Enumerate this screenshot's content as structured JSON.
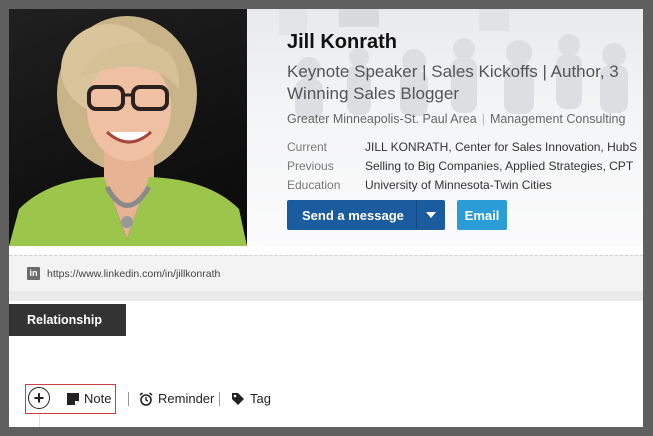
{
  "profile": {
    "name": "Jill Konrath",
    "headline_line1": "Keynote Speaker | Sales Kickoffs | Author, 3",
    "headline_line2": "Winning Sales Blogger",
    "location": "Greater Minneapolis-St. Paul Area",
    "industry": "Management Consulting",
    "details": [
      {
        "label": "Current",
        "value": "JILL KONRATH, Center for Sales Innovation, HubS"
      },
      {
        "label": "Previous",
        "value": "Selling to Big Companies, Applied Strategies, CPT"
      },
      {
        "label": "Education",
        "value": "University of Minnesota-Twin Cities"
      }
    ]
  },
  "buttons": {
    "send_message": "Send a message",
    "email": "Email"
  },
  "profile_url": "https://www.linkedin.com/in/jillkonrath",
  "linkedin_icon_text": "in",
  "tabs": {
    "relationship": "Relationship"
  },
  "actions": {
    "add_symbol": "+",
    "note": "Note",
    "reminder": "Reminder",
    "tag": "Tag"
  },
  "colors": {
    "primary_button": "#1b5c9e",
    "email_button": "#2a9cd6",
    "tab_dark": "#333333",
    "highlight_border": "#d23c3c"
  },
  "icons": [
    "linkedin-icon",
    "caret-down-icon",
    "plus-circle-icon",
    "note-icon",
    "alarm-clock-icon",
    "tag-icon"
  ]
}
